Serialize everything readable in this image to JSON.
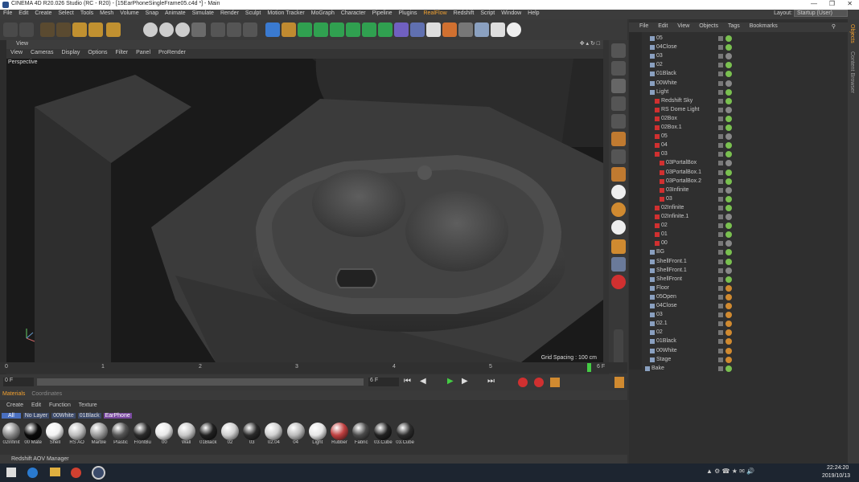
{
  "window": {
    "title": "CINEMA 4D R20.026 Studio (RC - R20) - [15EarPhoneSingleFrame05.c4d *] - Main"
  },
  "menu": [
    "File",
    "Edit",
    "Create",
    "Select",
    "Tools",
    "Mesh",
    "Volume",
    "Snap",
    "Animate",
    "Simulate",
    "Render",
    "Sculpt",
    "Motion Tracker",
    "MoGraph",
    "Character",
    "Pipeline",
    "Plugins",
    "RealFlow",
    "Redshift",
    "Script",
    "Window",
    "Help"
  ],
  "layout": {
    "label": "Layout:",
    "value": "Startup (User)"
  },
  "viewport": {
    "panel_title": "View",
    "menu": [
      "View",
      "Cameras",
      "Display",
      "Options",
      "Filter",
      "Panel",
      "ProRender"
    ],
    "camera_label": "Perspective",
    "grid_spacing": "Grid Spacing : 100 cm"
  },
  "timeline": {
    "ticks": [
      "0",
      "1",
      "2",
      "3",
      "4",
      "5",
      "6 F"
    ],
    "start_frame": "0 F",
    "end_frame": "6 F",
    "current_frame": "0 F",
    "range_end": "6 F"
  },
  "materials": {
    "tabs": [
      "Materials",
      "Coordinates"
    ],
    "menu": [
      "Create",
      "Edit",
      "Function",
      "Texture"
    ],
    "filters": [
      "All",
      "No Layer",
      "00White",
      "01Black",
      "EarPhone"
    ],
    "items": [
      {
        "label": "02Infinit",
        "color": "#8a8a8a"
      },
      {
        "label": "00 Mate",
        "color": "#0a0a0a"
      },
      {
        "label": "Shell",
        "color": "#f2f2f2"
      },
      {
        "label": "RS AO",
        "color": "#bdbdbd"
      },
      {
        "label": "Marble",
        "color": "#9a9a9a"
      },
      {
        "label": "Plastic",
        "color": "#555555"
      },
      {
        "label": "FrontBu",
        "color": "#2a2a2a"
      },
      {
        "label": "00",
        "color": "#e8e8e8"
      },
      {
        "label": "Wall",
        "color": "#c8c8c8"
      },
      {
        "label": "01Black",
        "color": "#202020"
      },
      {
        "label": "02",
        "color": "#cfcfcf"
      },
      {
        "label": "03",
        "color": "#2a2a2a"
      },
      {
        "label": "02.04",
        "color": "#d0d0d0"
      },
      {
        "label": "04",
        "color": "#bcbcbc"
      },
      {
        "label": "Light",
        "color": "#e6e6e6"
      },
      {
        "label": "Rubber",
        "color": "#c04040"
      },
      {
        "label": "Fabric",
        "color": "#4a4a4a"
      },
      {
        "label": "03.Cube",
        "color": "#222222"
      },
      {
        "label": "03.Cube",
        "color": "#2c2c2c"
      }
    ]
  },
  "status": {
    "redshift_aov": "Redshift AOV Manager"
  },
  "objects": {
    "menu": [
      "File",
      "Edit",
      "View",
      "Objects",
      "Tags",
      "Bookmarks"
    ],
    "rows": [
      {
        "name": "05",
        "indent": 1
      },
      {
        "name": "04Close",
        "indent": 1
      },
      {
        "name": "03",
        "indent": 1
      },
      {
        "name": "02",
        "indent": 1
      },
      {
        "name": "01Black",
        "indent": 1
      },
      {
        "name": "00White",
        "indent": 1
      },
      {
        "name": "Light",
        "indent": 1
      },
      {
        "name": "Redshift Sky",
        "indent": 2
      },
      {
        "name": "RS Dome Light",
        "indent": 2
      },
      {
        "name": "02Box",
        "indent": 2
      },
      {
        "name": "02Box.1",
        "indent": 2
      },
      {
        "name": "05",
        "indent": 2
      },
      {
        "name": "04",
        "indent": 2
      },
      {
        "name": "03",
        "indent": 2
      },
      {
        "name": "03PortalBox",
        "indent": 3
      },
      {
        "name": "03PortalBox.1",
        "indent": 3
      },
      {
        "name": "03PortalBox.2",
        "indent": 3
      },
      {
        "name": "03Infinite",
        "indent": 3
      },
      {
        "name": "03",
        "indent": 3
      },
      {
        "name": "02Infinite",
        "indent": 2
      },
      {
        "name": "02Infinite.1",
        "indent": 2
      },
      {
        "name": "02",
        "indent": 2
      },
      {
        "name": "01",
        "indent": 2
      },
      {
        "name": "00",
        "indent": 2
      },
      {
        "name": "BG",
        "indent": 1
      },
      {
        "name": "ShellFront.1",
        "indent": 1
      },
      {
        "name": "ShellFront.1",
        "indent": 1
      },
      {
        "name": "ShellFront",
        "indent": 1
      },
      {
        "name": "Floor",
        "indent": 1
      },
      {
        "name": "05Open",
        "indent": 1
      },
      {
        "name": "04Close",
        "indent": 1
      },
      {
        "name": "03",
        "indent": 1
      },
      {
        "name": "02.1",
        "indent": 1
      },
      {
        "name": "02",
        "indent": 1
      },
      {
        "name": "01Black",
        "indent": 1
      },
      {
        "name": "00White",
        "indent": 1
      },
      {
        "name": "Stage",
        "indent": 1
      },
      {
        "name": "Bake",
        "indent": 0
      }
    ],
    "side_tabs": [
      "Objects",
      "Content Browser"
    ]
  },
  "taskbar": {
    "time": "22:24:20",
    "date": "2019/10/13"
  }
}
